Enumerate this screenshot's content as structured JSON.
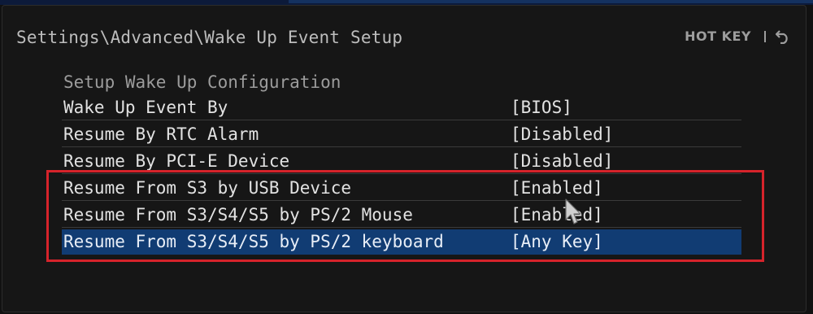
{
  "breadcrumb": "Settings\\Advanced\\Wake Up Event Setup",
  "hotkey": {
    "label": "HOT KEY",
    "back_icon": "back-arrow-icon"
  },
  "section_title": "Setup Wake Up Configuration",
  "settings": [
    {
      "label": "Wake Up Event By",
      "value": "[BIOS]"
    },
    {
      "label": "Resume By RTC Alarm",
      "value": "[Disabled]"
    },
    {
      "label": "Resume By PCI-E Device",
      "value": "[Disabled]"
    },
    {
      "label": "Resume From S3 by USB Device",
      "value": "[Enabled]"
    },
    {
      "label": "Resume From S3/S4/S5 by PS/2 Mouse",
      "value": "[Enabled]"
    },
    {
      "label": "Resume From S3/S4/S5 by PS/2 keyboard",
      "value": "[Any Key]",
      "selected": true
    }
  ],
  "colors": {
    "background": "#161616",
    "selection": "#113c73",
    "highlight_border": "#d6232b",
    "text": "#e2e2e2"
  }
}
